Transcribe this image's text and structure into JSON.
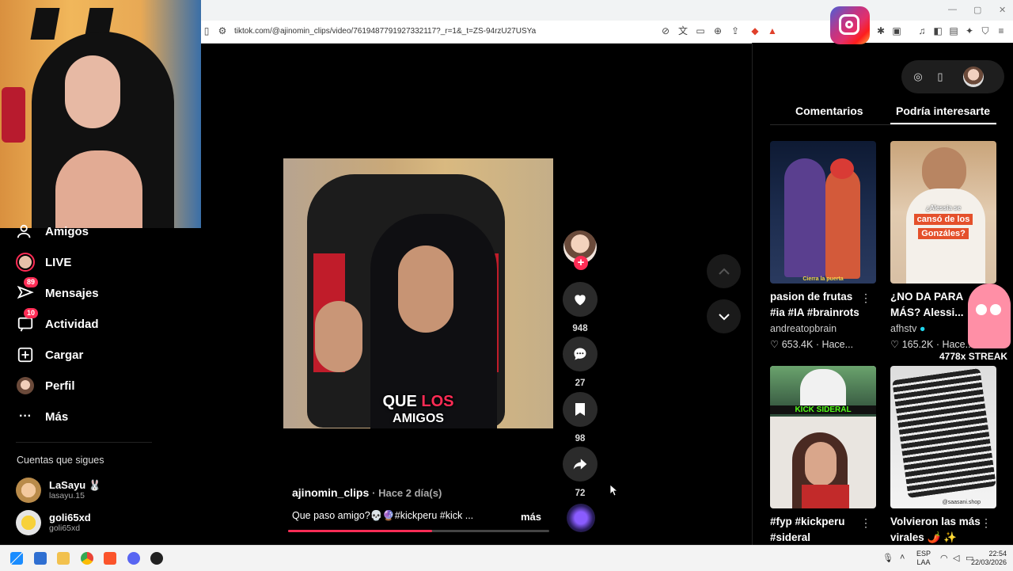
{
  "browser": {
    "url": "tiktok.com/@ajinomin_clips/video/7619487791927332117?_r=1&_t=ZS-94rzU27USYa",
    "window_controls": [
      "—",
      "▢",
      "✕"
    ]
  },
  "sidebar": {
    "items": [
      {
        "label": "Amigos",
        "icon": "friends-icon",
        "badge": ""
      },
      {
        "label": "LIVE",
        "icon": "live-icon",
        "badge": ""
      },
      {
        "label": "Mensajes",
        "icon": "messages-icon",
        "badge": "89"
      },
      {
        "label": "Actividad",
        "icon": "activity-icon",
        "badge": "10"
      },
      {
        "label": "Cargar",
        "icon": "upload-icon",
        "badge": ""
      },
      {
        "label": "Perfil",
        "icon": "profile-icon",
        "badge": ""
      },
      {
        "label": "Más",
        "icon": "more-icon",
        "badge": ""
      }
    ],
    "following_title": "Cuentas que sigues",
    "following": [
      {
        "name": "LaSayu 🐰",
        "handle": "lasayu.15"
      },
      {
        "name": "goli65xd",
        "handle": "goli65xd"
      }
    ]
  },
  "video": {
    "caption_word1": "QUE",
    "caption_highlight": "LOS",
    "caption_line2": "AMIGOS",
    "username": "ajinomin_clips",
    "time": "· Hace 2 día(s)",
    "description": "Que paso amigo?💀🔮#kickperu #kick ...",
    "more_label": "más",
    "progress": 0.55
  },
  "actions": {
    "likes": "948",
    "comments": "27",
    "saves": "98",
    "shares": "72"
  },
  "right_panel": {
    "tabs": [
      "Comentarios",
      "Podría interesarte"
    ],
    "active_tab": 1,
    "cards": [
      {
        "title": "pasion de frutas #ia #IA #brainrots",
        "author": "andreatopbrain",
        "likes": "653.4K",
        "time": "· Hace..."
      },
      {
        "title": "¿NO DA PARA MÁS? Alessi...",
        "author": "afhstv",
        "likes": "165.2K",
        "time": "· Hace..."
      },
      {
        "title": "#fyp #kickperu #sideral",
        "author": "",
        "likes": "",
        "time": ""
      },
      {
        "title": "Volvieron las más virales 🌶️ ✨",
        "author": "",
        "likes": "",
        "time": ""
      }
    ],
    "card_overlays": {
      "card1_caption": "Cierra la puerta",
      "card2_caption_top": "¿Alessia se",
      "card2_caption_mid": "cansó de los",
      "card2_caption_bot": "Gonzáles?",
      "card3_brand": "KICK SIDERAL",
      "card4_caption": "@saasani.shop"
    }
  },
  "overlay": {
    "streak": "4778x STREAK"
  },
  "taskbar": {
    "lang_top": "ESP",
    "lang_bottom": "LAA",
    "time": "22:54",
    "date": "22/03/2026"
  },
  "colors": {
    "accent": "#fe2c55",
    "background": "#000000"
  }
}
